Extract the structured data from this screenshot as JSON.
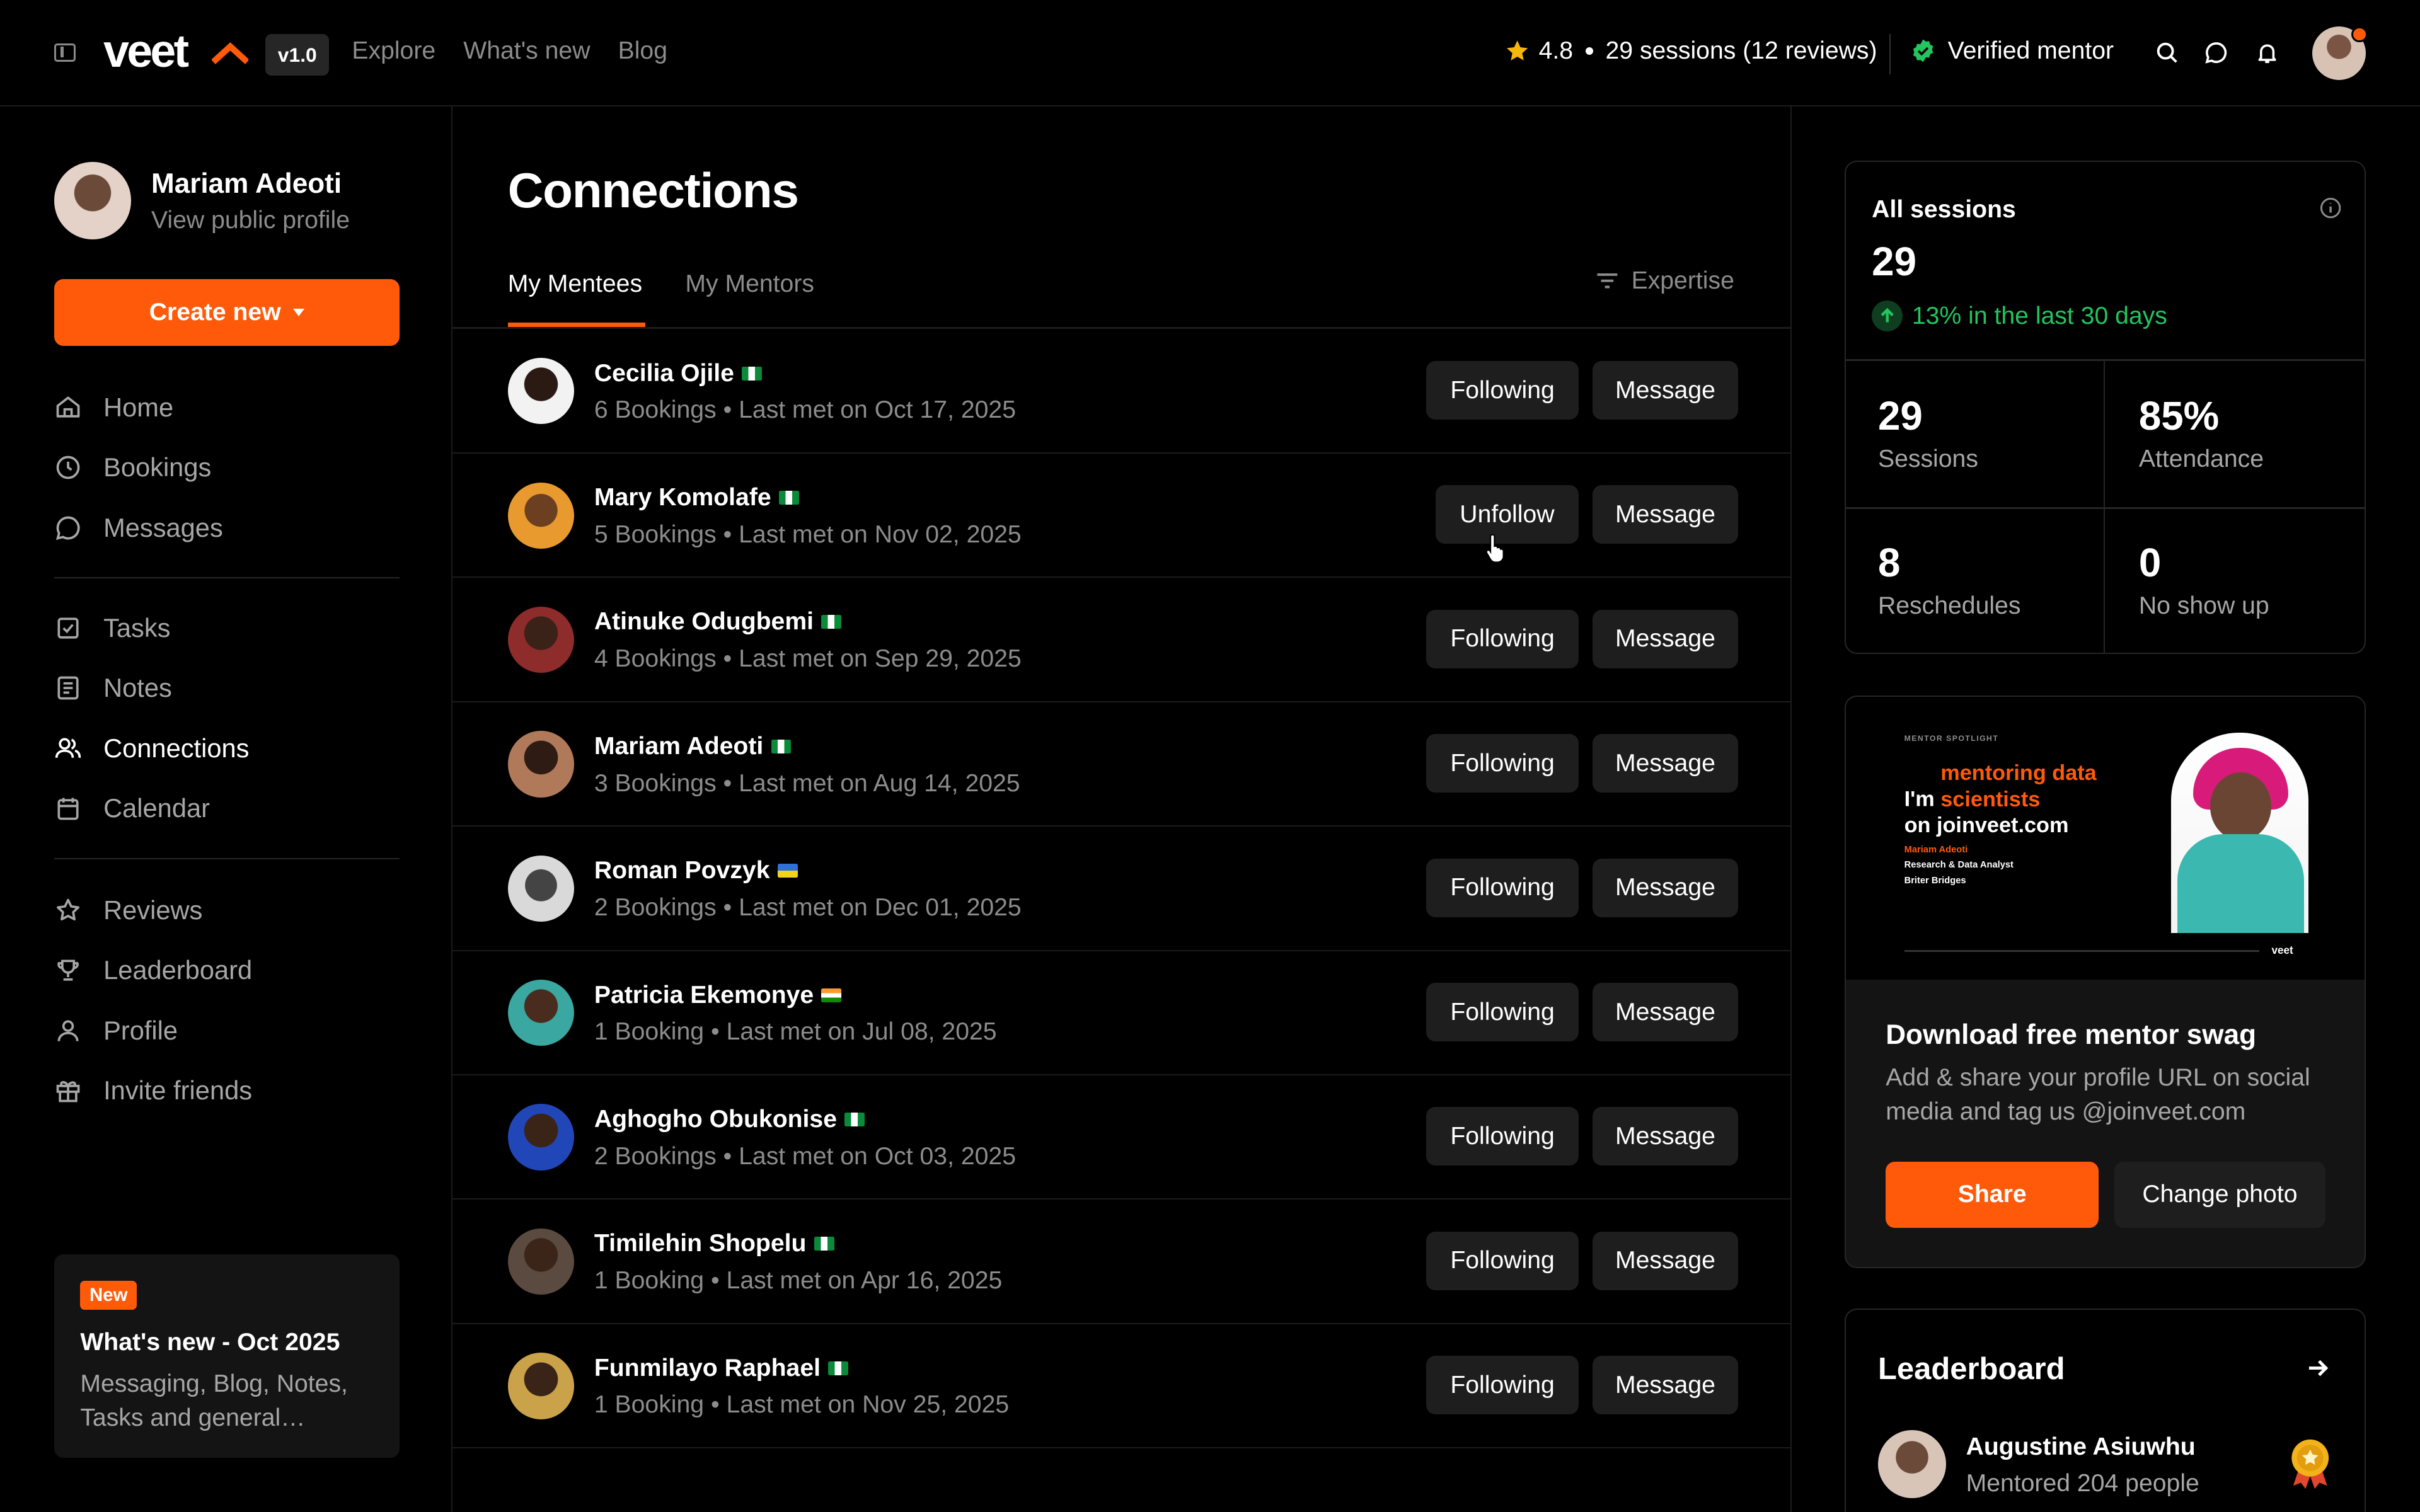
{
  "topbar": {
    "logo": "veet",
    "version": "v1.0",
    "nav": [
      "Explore",
      "What's new",
      "Blog"
    ],
    "rating": "4.8",
    "sessions": "29 sessions (12 reviews)",
    "verified": "Verified mentor"
  },
  "sidebar": {
    "profile_name": "Mariam Adeoti",
    "profile_link": "View public profile",
    "create_label": "Create new",
    "items": [
      {
        "label": "Home",
        "icon": "home-icon"
      },
      {
        "label": "Bookings",
        "icon": "clock-icon"
      },
      {
        "label": "Messages",
        "icon": "chat-icon"
      },
      {
        "label": "Tasks",
        "icon": "checkbox-icon"
      },
      {
        "label": "Notes",
        "icon": "notes-icon"
      },
      {
        "label": "Connections",
        "icon": "users-icon"
      },
      {
        "label": "Calendar",
        "icon": "calendar-icon"
      },
      {
        "label": "Reviews",
        "icon": "star-icon"
      },
      {
        "label": "Leaderboard",
        "icon": "trophy-icon"
      },
      {
        "label": "Profile",
        "icon": "user-icon"
      },
      {
        "label": "Invite friends",
        "icon": "gift-icon"
      }
    ],
    "whatsnew": {
      "badge": "New",
      "title": "What's new - Oct 2025",
      "desc": "Messaging, Blog, Notes, Tasks and general improvements"
    }
  },
  "main": {
    "title": "Connections",
    "tabs": [
      "My Mentees",
      "My Mentors"
    ],
    "filter_label": "Expertise",
    "rows": [
      {
        "name": "Cecilia Ojile",
        "flag": "ng",
        "meta": "6 Bookings • Last met on Oct 17, 2025",
        "action": "Following",
        "message": "Message"
      },
      {
        "name": "Mary Komolafe",
        "flag": "ng",
        "meta": "5 Bookings • Last met on Nov 02, 2025",
        "action": "Unfollow",
        "message": "Message"
      },
      {
        "name": "Atinuke Odugbemi",
        "flag": "ng",
        "meta": "4 Bookings • Last met on Sep 29, 2025",
        "action": "Following",
        "message": "Message"
      },
      {
        "name": "Mariam Adeoti",
        "flag": "ng",
        "meta": "3 Bookings • Last met on Aug 14, 2025",
        "action": "Following",
        "message": "Message"
      },
      {
        "name": "Roman Povzyk",
        "flag": "ua",
        "meta": "2 Bookings • Last met on Dec 01, 2025",
        "action": "Following",
        "message": "Message"
      },
      {
        "name": "Patricia Ekemonye",
        "flag": "in",
        "meta": "1 Booking • Last met on Jul 08, 2025",
        "action": "Following",
        "message": "Message"
      },
      {
        "name": "Aghogho Obukonise",
        "flag": "ng",
        "meta": "2 Bookings • Last met on Oct 03, 2025",
        "action": "Following",
        "message": "Message"
      },
      {
        "name": "Timilehin Shopelu",
        "flag": "ng",
        "meta": "1 Booking • Last met on Apr 16, 2025",
        "action": "Following",
        "message": "Message"
      },
      {
        "name": "Funmilayo Raphael",
        "flag": "ng",
        "meta": "1 Booking • Last met on Nov 25, 2025",
        "action": "Following",
        "message": "Message"
      }
    ]
  },
  "stats": {
    "label": "All sessions",
    "total": "29",
    "trend": "13% in the last 30 days",
    "cells": [
      {
        "value": "29",
        "label": "Sessions"
      },
      {
        "value": "85%",
        "label": "Attendance"
      },
      {
        "value": "8",
        "label": "Reschedules"
      },
      {
        "value": "0",
        "label": "No show up"
      }
    ]
  },
  "swag": {
    "spotlight_kicker": "MENTOR SPOTLIGHT",
    "headline_1": "I'm ",
    "headline_orange": "mentoring data scientists",
    "headline_2": "on joinveet.com",
    "person_name": "Mariam Adeoti",
    "person_role": "Research & Data Analyst",
    "person_org": "Briter Bridges",
    "footer_logo": "veet",
    "title": "Download free mentor swag",
    "desc": "Add & share your profile URL on social media and tag us @joinveet.com",
    "share_label": "Share",
    "photo_label": "Change photo"
  },
  "leaderboard": {
    "title": "Leaderboard",
    "name": "Augustine Asiuwhu",
    "sub": "Mentored 204 people"
  },
  "colors": {
    "accent": "#ff5a0a",
    "success": "#22c55e"
  }
}
